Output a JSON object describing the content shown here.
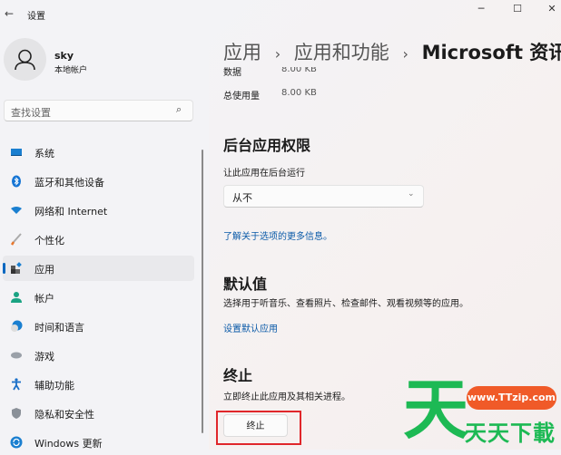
{
  "window": {
    "title": "设置",
    "controls": [
      "minimize",
      "maximize",
      "close"
    ]
  },
  "account": {
    "name": "sky",
    "type": "本地帐户"
  },
  "search": {
    "placeholder": "查找设置"
  },
  "sidebar": {
    "items": [
      {
        "label": "系统",
        "icon": "system-icon"
      },
      {
        "label": "蓝牙和其他设备",
        "icon": "bluetooth-icon"
      },
      {
        "label": "网络和 Internet",
        "icon": "wifi-icon"
      },
      {
        "label": "个性化",
        "icon": "brush-icon"
      },
      {
        "label": "应用",
        "icon": "apps-icon",
        "selected": true
      },
      {
        "label": "帐户",
        "icon": "account-icon"
      },
      {
        "label": "时间和语言",
        "icon": "clock-globe-icon"
      },
      {
        "label": "游戏",
        "icon": "gamepad-icon"
      },
      {
        "label": "辅助功能",
        "icon": "accessibility-icon"
      },
      {
        "label": "隐私和安全性",
        "icon": "shield-icon"
      },
      {
        "label": "Windows 更新",
        "icon": "update-icon"
      }
    ]
  },
  "breadcrumb": {
    "items": [
      "应用",
      "应用和功能",
      "Microsoft 资讯"
    ],
    "separator": "›"
  },
  "usage": {
    "data_label": "数据",
    "data_value": "8.00 KB",
    "total_label": "总使用量",
    "total_value": "8.00 KB"
  },
  "background": {
    "heading": "后台应用权限",
    "label": "让此应用在后台运行",
    "selected": "从不",
    "link": "了解关于选项的更多信息。"
  },
  "defaults": {
    "heading": "默认值",
    "desc": "选择用于听音乐、查看照片、检查邮件、观看视频等的应用。",
    "link": "设置默认应用"
  },
  "terminate": {
    "heading": "终止",
    "desc": "立即终止此应用及其相关进程。",
    "button": "终止"
  },
  "watermark": {
    "url": "www.TTzip.com",
    "text": "天天下載",
    "big": "天"
  },
  "colors": {
    "accent": "#0067c0",
    "link": "#0a5aa8",
    "highlight": "#e0262a",
    "watermark_green": "#1db954",
    "watermark_orange": "#f05a28"
  }
}
